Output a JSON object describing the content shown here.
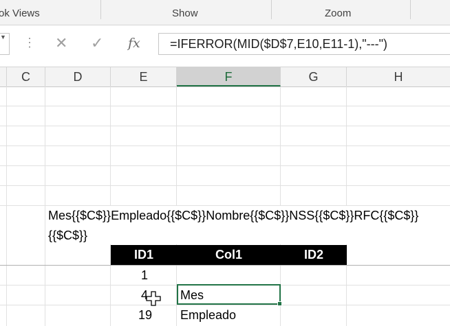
{
  "ribbon": {
    "groups": [
      {
        "label": "ok Views"
      },
      {
        "label": "Show"
      },
      {
        "label": "Zoom"
      }
    ]
  },
  "formula_bar": {
    "cancel_icon": "close-icon",
    "enter_icon": "checkmark-icon",
    "fx_label": "fx",
    "formula": "=IFERROR(MID($D$7,E10,E11-1),\"---\")"
  },
  "columns": [
    "C",
    "D",
    "E",
    "F",
    "G",
    "H"
  ],
  "selected_column": "F",
  "cells": {
    "d7_line1": "Mes{{$C$}}Empleado{{$C$}}Nombre{{$C$}}NSS{{$C$}}RFC{{$C$}}",
    "d7_line2": "{{$C$}}",
    "table_headers": [
      "ID1",
      "Col1",
      "ID2"
    ],
    "rows": [
      {
        "id1": "1",
        "col1": ""
      },
      {
        "id1": "4",
        "col1": "Mes"
      },
      {
        "id1": "19",
        "col1": "Empleado"
      }
    ]
  },
  "colors": {
    "selection_accent": "#217346",
    "table_header_bg": "#000000",
    "table_header_text": "#ffffff"
  }
}
